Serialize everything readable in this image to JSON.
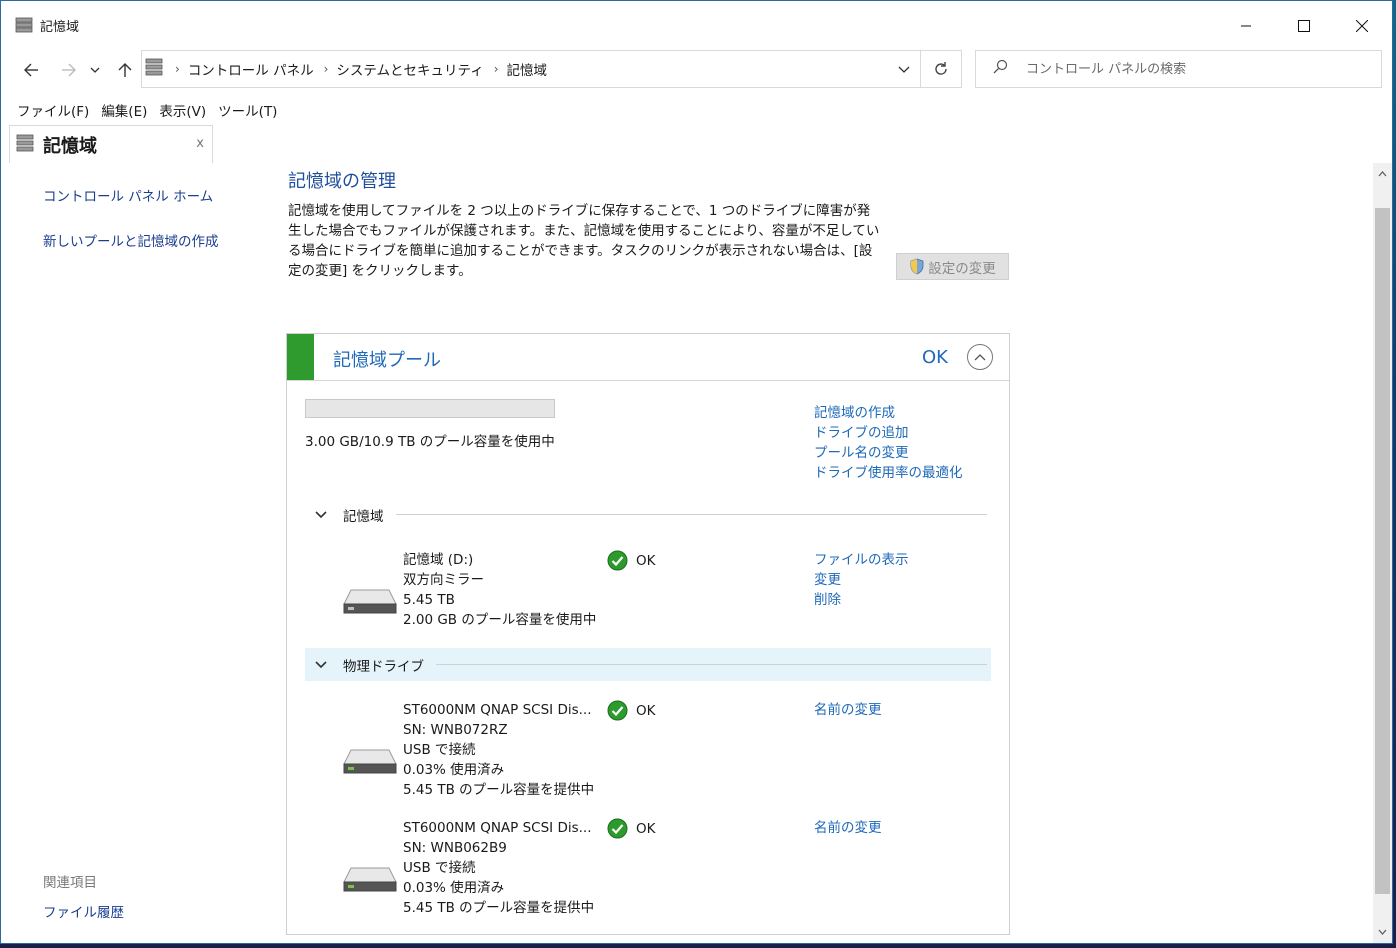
{
  "window": {
    "title": "記憶域",
    "controls": {
      "minimize": "minimize-icon",
      "maximize": "maximize-icon",
      "close": "close-icon"
    }
  },
  "address": {
    "crumbs": [
      "コントロール パネル",
      "システムとセキュリティ",
      "記憶域"
    ],
    "search_placeholder": "コントロール パネルの検索"
  },
  "menu": [
    "ファイル(F)",
    "編集(E)",
    "表示(V)",
    "ツール(T)"
  ],
  "sidebar": {
    "tab_title": "記憶域",
    "tab_close": "x",
    "links": [
      "コントロール パネル ホーム",
      "新しいプールと記憶域の作成"
    ],
    "related_heading": "関連項目",
    "related_links": [
      "ファイル履歴"
    ]
  },
  "main": {
    "title": "記憶域の管理",
    "description": "記憶域を使用してファイルを 2 つ以上のドライブに保存することで、1 つのドライブに障害が発生した場合でもファイルが保護されます。また、記憶域を使用することにより、容量が不足している場合にドライブを簡単に追加することができます。タスクのリンクが表示されない場合は、[設定の変更] をクリックします。",
    "settings_button": "設定の変更"
  },
  "pool": {
    "title": "記憶域プール",
    "status": "OK",
    "usage_fraction": 0.0003,
    "usage_text": "3.00 GB/10.9 TB のプール容量を使用中",
    "links": [
      "記憶域の作成",
      "ドライブの追加",
      "プール名の変更",
      "ドライブ使用率の最適化"
    ],
    "spaces_section": "記憶域",
    "spaces": [
      {
        "lines": [
          "記憶域 (D:)",
          "双方向ミラー",
          "5.45 TB",
          "2.00 GB のプール容量を使用中"
        ],
        "status": "OK",
        "links": [
          "ファイルの表示",
          "変更",
          "削除"
        ]
      }
    ],
    "drives_section": "物理ドライブ",
    "drives": [
      {
        "lines": [
          "ST6000NM QNAP SCSI Dis...",
          "SN: WNB072RZ",
          "USB で接続",
          "0.03% 使用済み",
          "5.45 TB のプール容量を提供中"
        ],
        "status": "OK",
        "links": [
          "名前の変更"
        ]
      },
      {
        "lines": [
          "ST6000NM QNAP SCSI Dis...",
          "SN: WNB062B9",
          "USB で接続",
          "0.03% 使用済み",
          "5.45 TB のプール容量を提供中"
        ],
        "status": "OK",
        "links": [
          "名前の変更"
        ]
      }
    ]
  },
  "colors": {
    "accent": "#1e6ab8",
    "pool_status_bar": "#2f9b2f",
    "ok_icon": "#2c9a2c"
  }
}
